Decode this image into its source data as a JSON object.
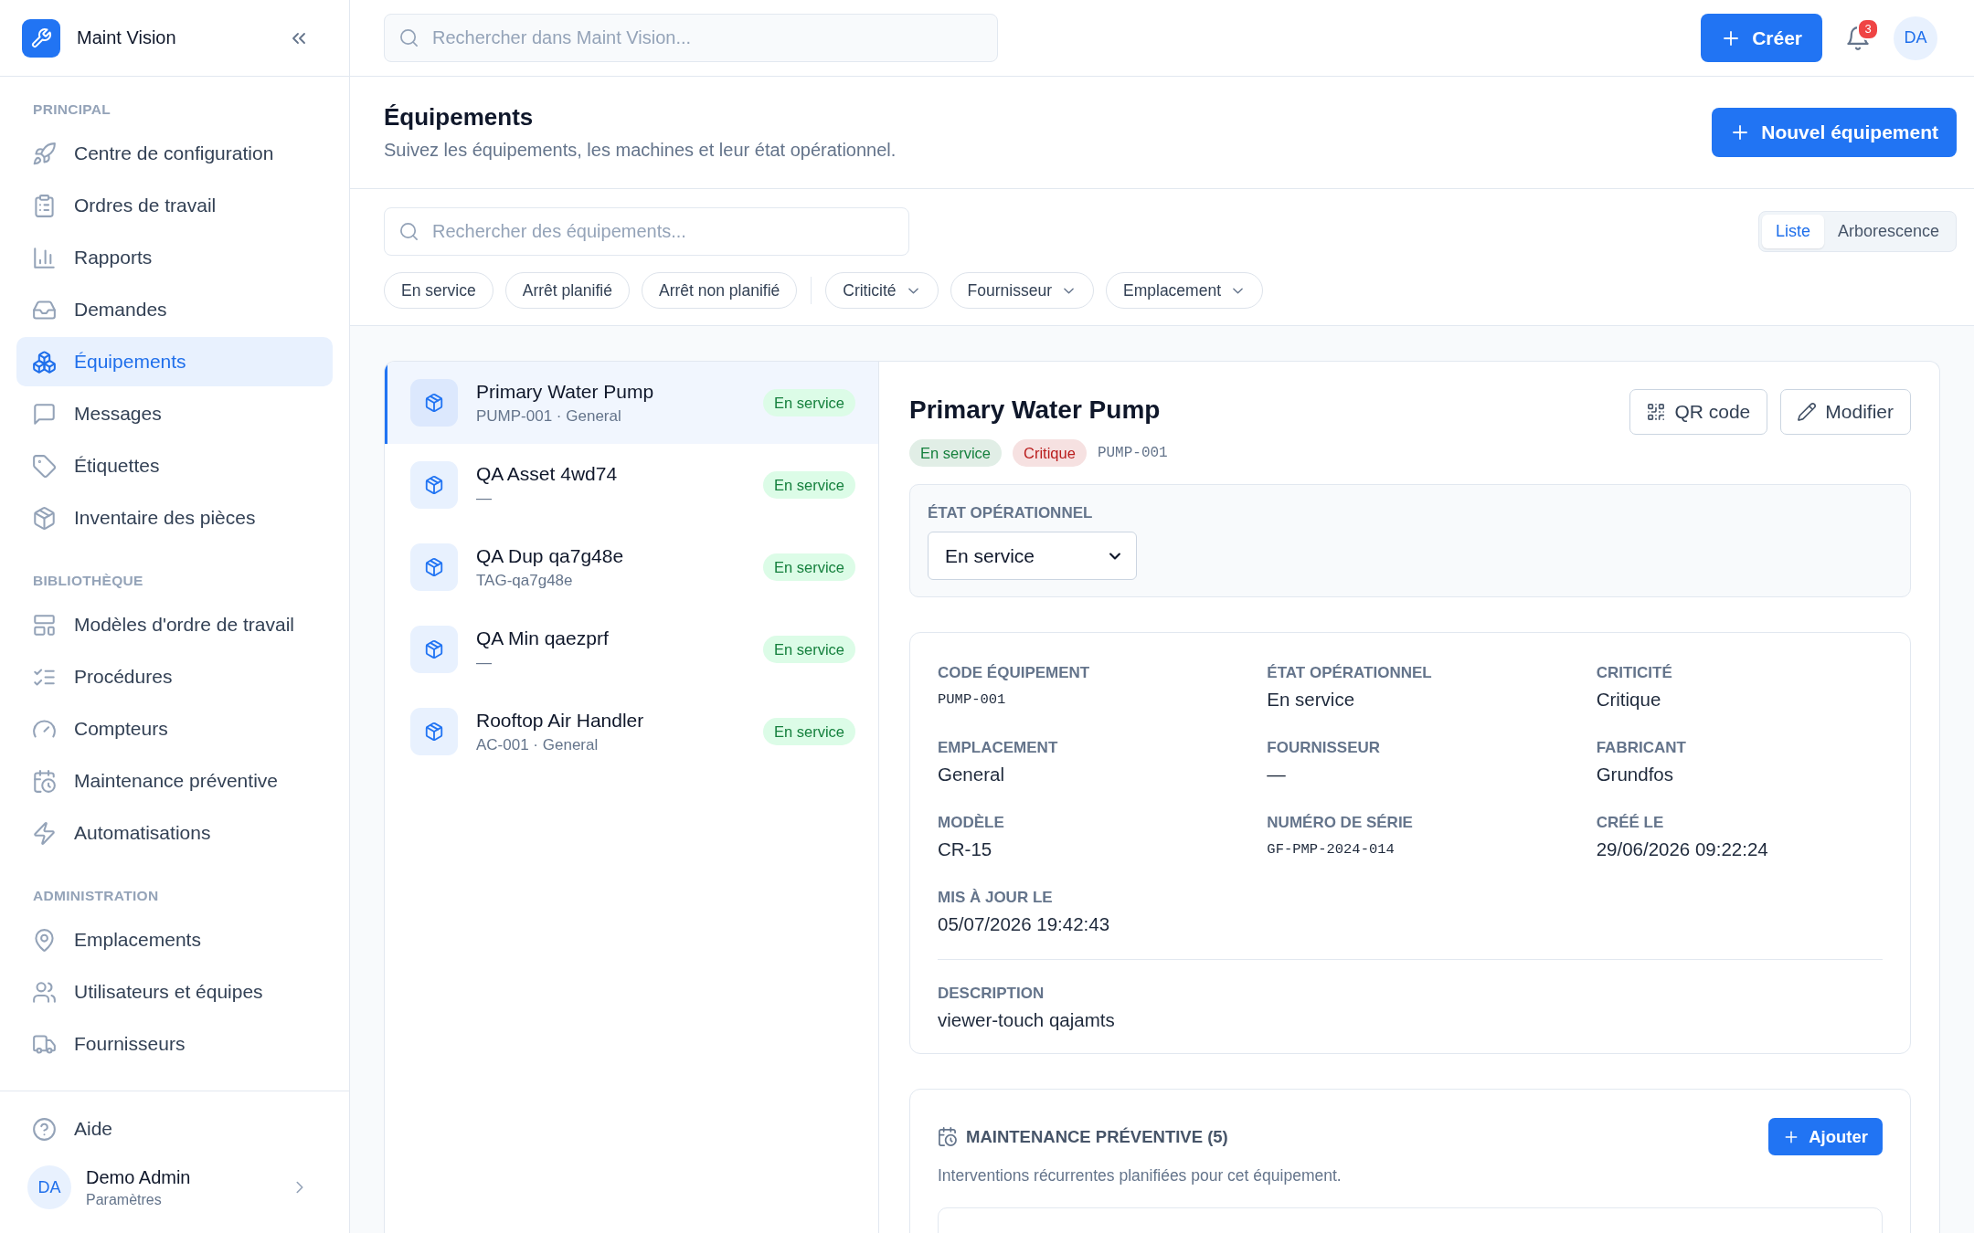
{
  "app": {
    "name": "Maint Vision"
  },
  "sidebar": {
    "sections": [
      {
        "title": "PRINCIPAL",
        "items": [
          {
            "label": "Centre de configuration",
            "selected": false
          },
          {
            "label": "Ordres de travail",
            "selected": false
          },
          {
            "label": "Rapports",
            "selected": false
          },
          {
            "label": "Demandes",
            "selected": false
          },
          {
            "label": "Équipements",
            "selected": true
          },
          {
            "label": "Messages",
            "selected": false
          },
          {
            "label": "Étiquettes",
            "selected": false
          },
          {
            "label": "Inventaire des pièces",
            "selected": false
          }
        ]
      },
      {
        "title": "BIBLIOTHÈQUE",
        "items": [
          {
            "label": "Modèles d'ordre de travail",
            "selected": false
          },
          {
            "label": "Procédures",
            "selected": false
          },
          {
            "label": "Compteurs",
            "selected": false
          },
          {
            "label": "Maintenance préventive",
            "selected": false
          },
          {
            "label": "Automatisations",
            "selected": false
          }
        ]
      },
      {
        "title": "ADMINISTRATION",
        "items": [
          {
            "label": "Emplacements",
            "selected": false
          },
          {
            "label": "Utilisateurs et équipes",
            "selected": false
          },
          {
            "label": "Fournisseurs",
            "selected": false
          }
        ]
      }
    ],
    "help": {
      "label": "Aide"
    },
    "user": {
      "initials": "DA",
      "name": "Demo Admin",
      "subtitle": "Paramètres"
    }
  },
  "top_bar": {
    "search": {
      "placeholder": "Rechercher dans Maint Vision..."
    },
    "create_button": "Créer",
    "notifications": {
      "count": "3"
    },
    "avatar": "DA"
  },
  "page_header": {
    "title": "Équipements",
    "subtitle": "Suivez les équipements, les machines et leur état opérationnel.",
    "primary_button": "Nouvel équipement"
  },
  "filters": {
    "search": {
      "placeholder": "Rechercher des équipements..."
    },
    "chips": [
      {
        "label": "En service",
        "kind": "toggle"
      },
      {
        "label": "Arrêt planifié",
        "kind": "toggle"
      },
      {
        "label": "Arrêt non planifié",
        "kind": "toggle"
      },
      {
        "label": "Criticité",
        "kind": "dropdown"
      },
      {
        "label": "Fournisseur",
        "kind": "dropdown"
      },
      {
        "label": "Emplacement",
        "kind": "dropdown"
      }
    ],
    "view_toggle": [
      {
        "label": "Liste",
        "selected": true
      },
      {
        "label": "Arborescence",
        "selected": false
      }
    ]
  },
  "asset_list": [
    {
      "name": "Primary Water Pump",
      "subtitle": "PUMP-001 · General",
      "status": "En service",
      "selected": true
    },
    {
      "name": "QA Asset 4wd74",
      "subtitle": "—",
      "status": "En service",
      "selected": false
    },
    {
      "name": "QA Dup qa7g48e",
      "subtitle": "TAG-qa7g48e",
      "status": "En service",
      "selected": false
    },
    {
      "name": "QA Min qaezprf",
      "subtitle": "—",
      "status": "En service",
      "selected": false
    },
    {
      "name": "Rooftop Air Handler",
      "subtitle": "AC-001 · General",
      "status": "En service",
      "selected": false
    }
  ],
  "detail": {
    "title": "Primary Water Pump",
    "badges": [
      {
        "label": "En service",
        "color": "#15803d"
      },
      {
        "label": "Critique",
        "color": "#b91c1c"
      }
    ],
    "code": "PUMP-001",
    "actions": [
      "QR code",
      "Modifier"
    ],
    "status_panel": {
      "label": "ÉTAT OPÉRATIONNEL",
      "value": "En service"
    },
    "fields": [
      {
        "label": "CODE ÉQUIPEMENT",
        "value": "PUMP-001",
        "kind": "mono"
      },
      {
        "label": "ÉTAT OPÉRATIONNEL",
        "value": "En service",
        "kind": "text"
      },
      {
        "label": "CRITICITÉ",
        "value": "Critique",
        "kind": "text"
      },
      {
        "label": "EMPLACEMENT",
        "value": "General",
        "kind": "text"
      },
      {
        "label": "FOURNISSEUR",
        "value": "—",
        "kind": "text"
      },
      {
        "label": "FABRICANT",
        "value": "Grundfos",
        "kind": "text"
      },
      {
        "label": "MODÈLE",
        "value": "CR-15",
        "kind": "text"
      },
      {
        "label": "NUMÉRO DE SÉRIE",
        "value": "GF-PMP-2024-014",
        "kind": "mono"
      },
      {
        "label": "CRÉÉ LE",
        "value": "29/06/2026 09:22:24",
        "kind": "text"
      },
      {
        "label": "MIS À JOUR LE",
        "value": "05/07/2026 19:42:43",
        "kind": "text"
      }
    ],
    "description": {
      "label": "DESCRIPTION",
      "value": "viewer-touch qajamts"
    },
    "maintenance": {
      "title": "MAINTENANCE PRÉVENTIVE (5)",
      "button": "Ajouter",
      "description": "Interventions récurrentes planifiées pour cet équipement."
    }
  }
}
